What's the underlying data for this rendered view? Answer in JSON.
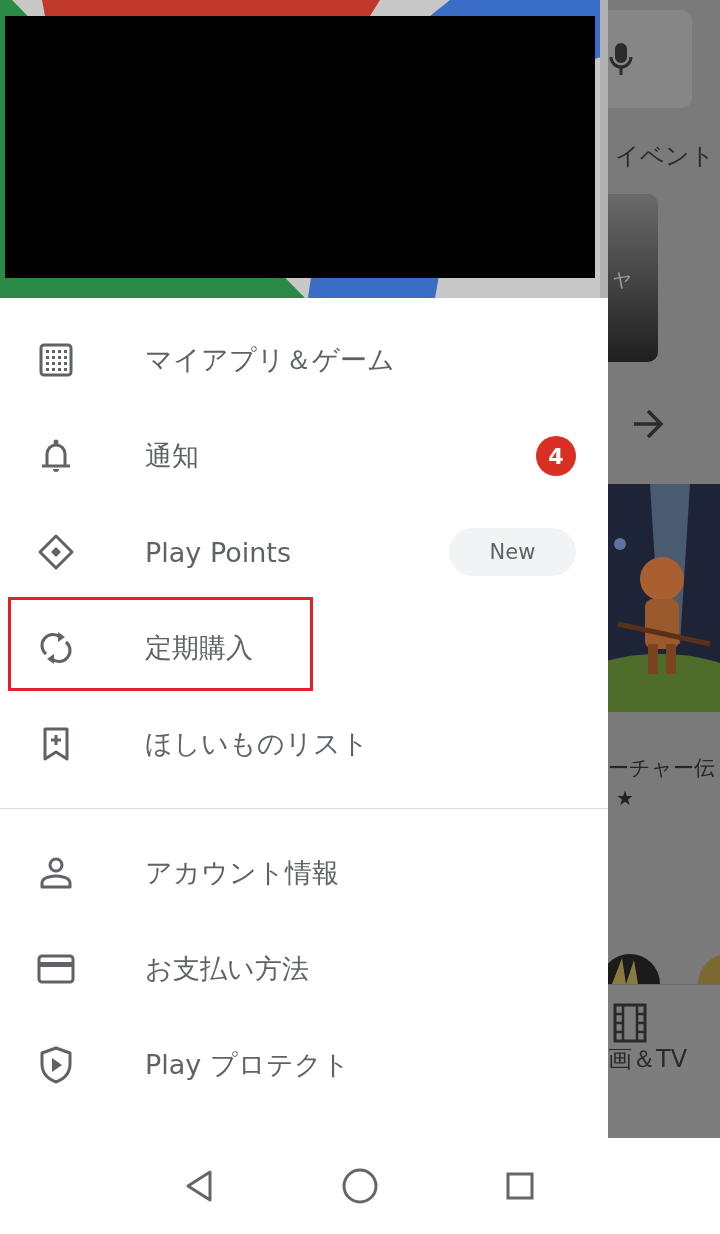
{
  "background_app": {
    "tab_label": "イベント",
    "card_text": "ャ",
    "app_title": "ーチャー伝",
    "rating": "★",
    "bottom_nav_label": "画＆TV"
  },
  "drawer": {
    "sections": [
      {
        "items": [
          {
            "label": "マイアプリ＆ゲーム",
            "highlighted": false
          },
          {
            "label": "通知",
            "badge": "4",
            "highlighted": false
          },
          {
            "label": "Play Points",
            "tag": "New",
            "highlighted": false
          },
          {
            "label": "定期購入",
            "highlighted": true
          },
          {
            "label": "ほしいものリスト",
            "highlighted": false
          }
        ]
      },
      {
        "items": [
          {
            "label": "アカウント情報",
            "highlighted": false
          },
          {
            "label": "お支払い方法",
            "highlighted": false
          },
          {
            "label": "Play プロテクト",
            "highlighted": false
          }
        ]
      }
    ]
  }
}
